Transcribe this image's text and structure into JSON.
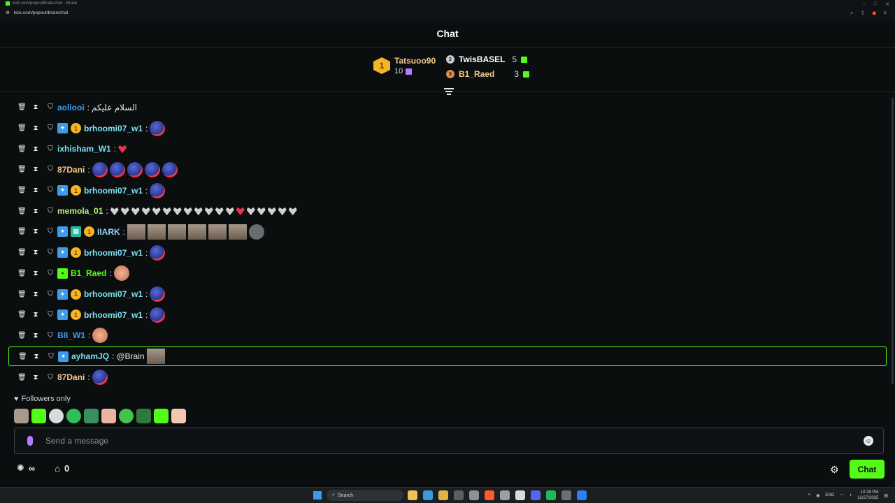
{
  "browser": {
    "window_title": "kick.com/popout/brain/chat - Brave",
    "url": "kick.com/popout/brain/chat"
  },
  "header": {
    "title": "Chat"
  },
  "leaderboard": {
    "first": {
      "rank": "1",
      "name": "Tatsuoo90",
      "count": "10"
    },
    "second": {
      "rank": "2",
      "name": "TwisBASEL",
      "count": "5"
    },
    "third": {
      "rank": "3",
      "name": "B1_Raed",
      "count": "3"
    }
  },
  "messages": [
    {
      "user": "aoliooi",
      "text": "السلام عليكم",
      "color": "#3d9be9"
    },
    {
      "user": "brhoomi07_w1",
      "text": "",
      "color": "#7ee0f0"
    },
    {
      "user": "ixhisham_W1",
      "text": "",
      "color": "#7ee0f0"
    },
    {
      "user": "87Dani",
      "text": "",
      "color": "#f5c88b"
    },
    {
      "user": "brhoomi07_w1",
      "text": "",
      "color": "#7ee0f0"
    },
    {
      "user": "memola_01",
      "text": "",
      "color": "#b9f27a"
    },
    {
      "user": "IIARK",
      "text": "",
      "color": "#8fd4ff"
    },
    {
      "user": "brhoomi07_w1",
      "text": "",
      "color": "#7ee0f0"
    },
    {
      "user": "B1_Raed",
      "text": "",
      "color": "#53fc18"
    },
    {
      "user": "brhoomi07_w1",
      "text": "",
      "color": "#7ee0f0"
    },
    {
      "user": "brhoomi07_w1",
      "text": "",
      "color": "#7ee0f0"
    },
    {
      "user": "B8_W1",
      "text": "",
      "color": "#3d9be9"
    },
    {
      "user": "ayhamJQ",
      "text": "@Brain",
      "color": "#7ee0f0"
    },
    {
      "user": "87Dani",
      "text": "",
      "color": "#f5c88b"
    }
  ],
  "footer": {
    "followers_only": "Followers only",
    "input_placeholder": "Send a message",
    "infinity_label": "∞",
    "store_count": "0",
    "chat_button": "Chat"
  },
  "taskbar": {
    "search_label": "Search",
    "lang": "ENG",
    "time": "10:28 PM",
    "date": "12/27/2025"
  },
  "colors": {
    "accent": "#53fc18",
    "background": "#0b0e0f"
  }
}
